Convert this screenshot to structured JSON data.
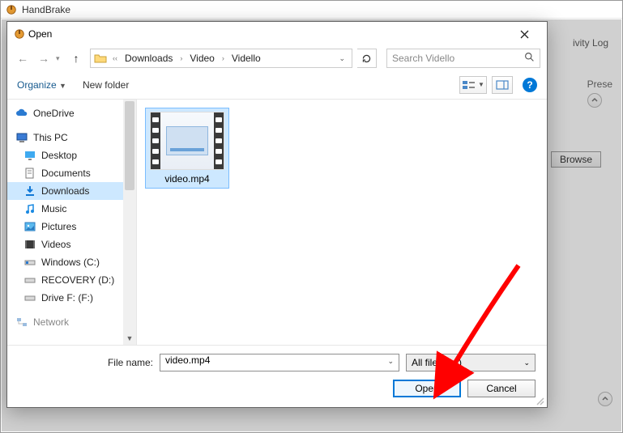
{
  "hb": {
    "title": "HandBrake",
    "toolbar_right": "ivity Log",
    "presets_label": "Prese",
    "browse_label": "Browse"
  },
  "dialog": {
    "title": "Open",
    "breadcrumb": {
      "a": "Downloads",
      "b": "Video",
      "c": "Vidello"
    },
    "search_placeholder": "Search Vidello",
    "cmd": {
      "organize": "Organize",
      "newfolder": "New folder"
    },
    "help": "?",
    "tree": {
      "onedrive": "OneDrive",
      "thispc": "This PC",
      "desktop": "Desktop",
      "documents": "Documents",
      "downloads": "Downloads",
      "music": "Music",
      "pictures": "Pictures",
      "videos": "Videos",
      "cdrive": "Windows (C:)",
      "ddrive": "RECOVERY (D:)",
      "fdrive": "Drive F: (F:)",
      "network": "Network"
    },
    "file": {
      "name": "video.mp4"
    },
    "footer": {
      "filename_label": "File name:",
      "filename_value": "video.mp4",
      "filter_label": "All files (*.*)",
      "open": "Open",
      "cancel": "Cancel"
    }
  }
}
